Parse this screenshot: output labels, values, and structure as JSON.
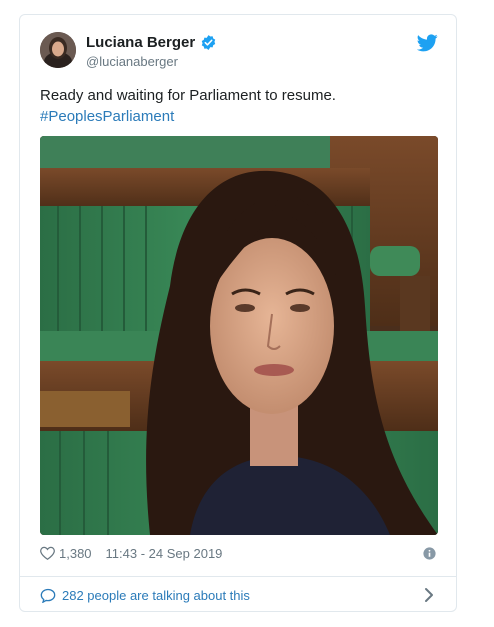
{
  "tweet": {
    "author_name": "Luciana Berger",
    "handle": "@lucianaberger",
    "text_line": "Ready and waiting for Parliament to resume.",
    "hashtag": "#PeoplesParliament",
    "likes": "1,380",
    "timestamp": "11:43 - 24 Sep 2019",
    "conversation": "282 people are talking about this"
  },
  "colors": {
    "link": "#2b7bb9",
    "muted": "#697882",
    "verified": "#1da1f2",
    "bench_green": "#2f7a4c"
  },
  "icons": [
    "verified-badge-icon",
    "twitter-bird-icon",
    "heart-icon",
    "info-icon",
    "speech-bubble-icon",
    "chevron-right-icon"
  ]
}
